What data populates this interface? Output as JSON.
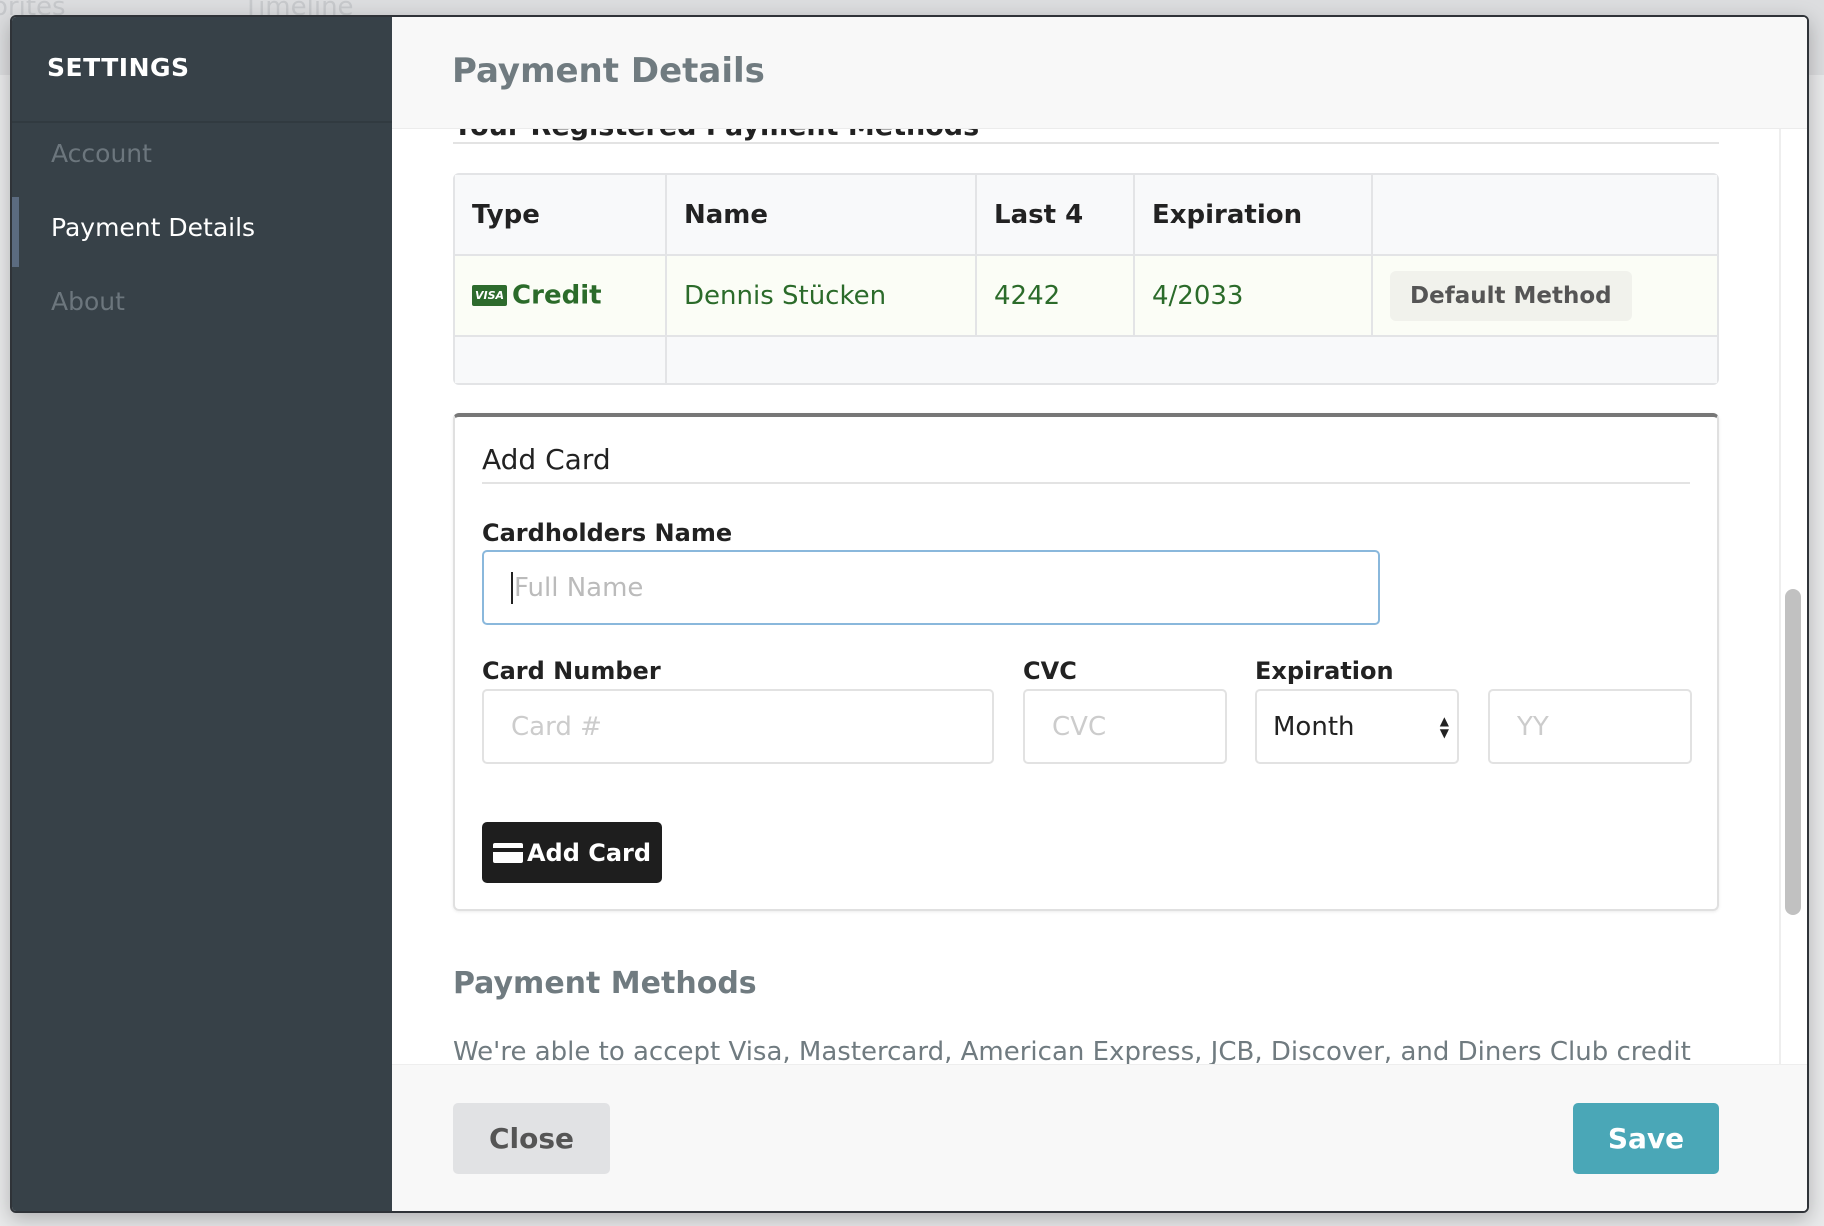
{
  "background": {
    "tabs": [
      "orites",
      "Timeline"
    ]
  },
  "sidebar": {
    "title": "SETTINGS",
    "items": [
      {
        "label": "Account"
      },
      {
        "label": "Payment Details",
        "active": true
      },
      {
        "label": "About"
      }
    ]
  },
  "header": {
    "title": "Payment Details"
  },
  "registered": {
    "title": "Your Registered Payment Methods",
    "columns": [
      "Type",
      "Name",
      "Last 4",
      "Expiration",
      ""
    ],
    "rows": [
      {
        "card_brand": "VISA",
        "type": "Credit",
        "name": "Dennis Stücken",
        "last4": "4242",
        "expiration": "4/2033",
        "badge": "Default Method"
      }
    ]
  },
  "add_card": {
    "title": "Add Card",
    "name_label": "Cardholders Name",
    "name_placeholder": "Full Name",
    "number_label": "Card Number",
    "number_placeholder": "Card #",
    "cvc_label": "CVC",
    "cvc_placeholder": "CVC",
    "expiration_label": "Expiration",
    "month_value": "Month",
    "year_placeholder": "YY",
    "button": "Add Card"
  },
  "payment_methods": {
    "title": "Payment Methods",
    "text": "We're able to accept Visa, Mastercard, American Express, JCB, Discover, and Diners Club credit"
  },
  "footer": {
    "close": "Close",
    "save": "Save"
  },
  "colors": {
    "sidebar": "#374148",
    "accent": "#4aa7b7",
    "success_text": "#2b6b2a"
  }
}
